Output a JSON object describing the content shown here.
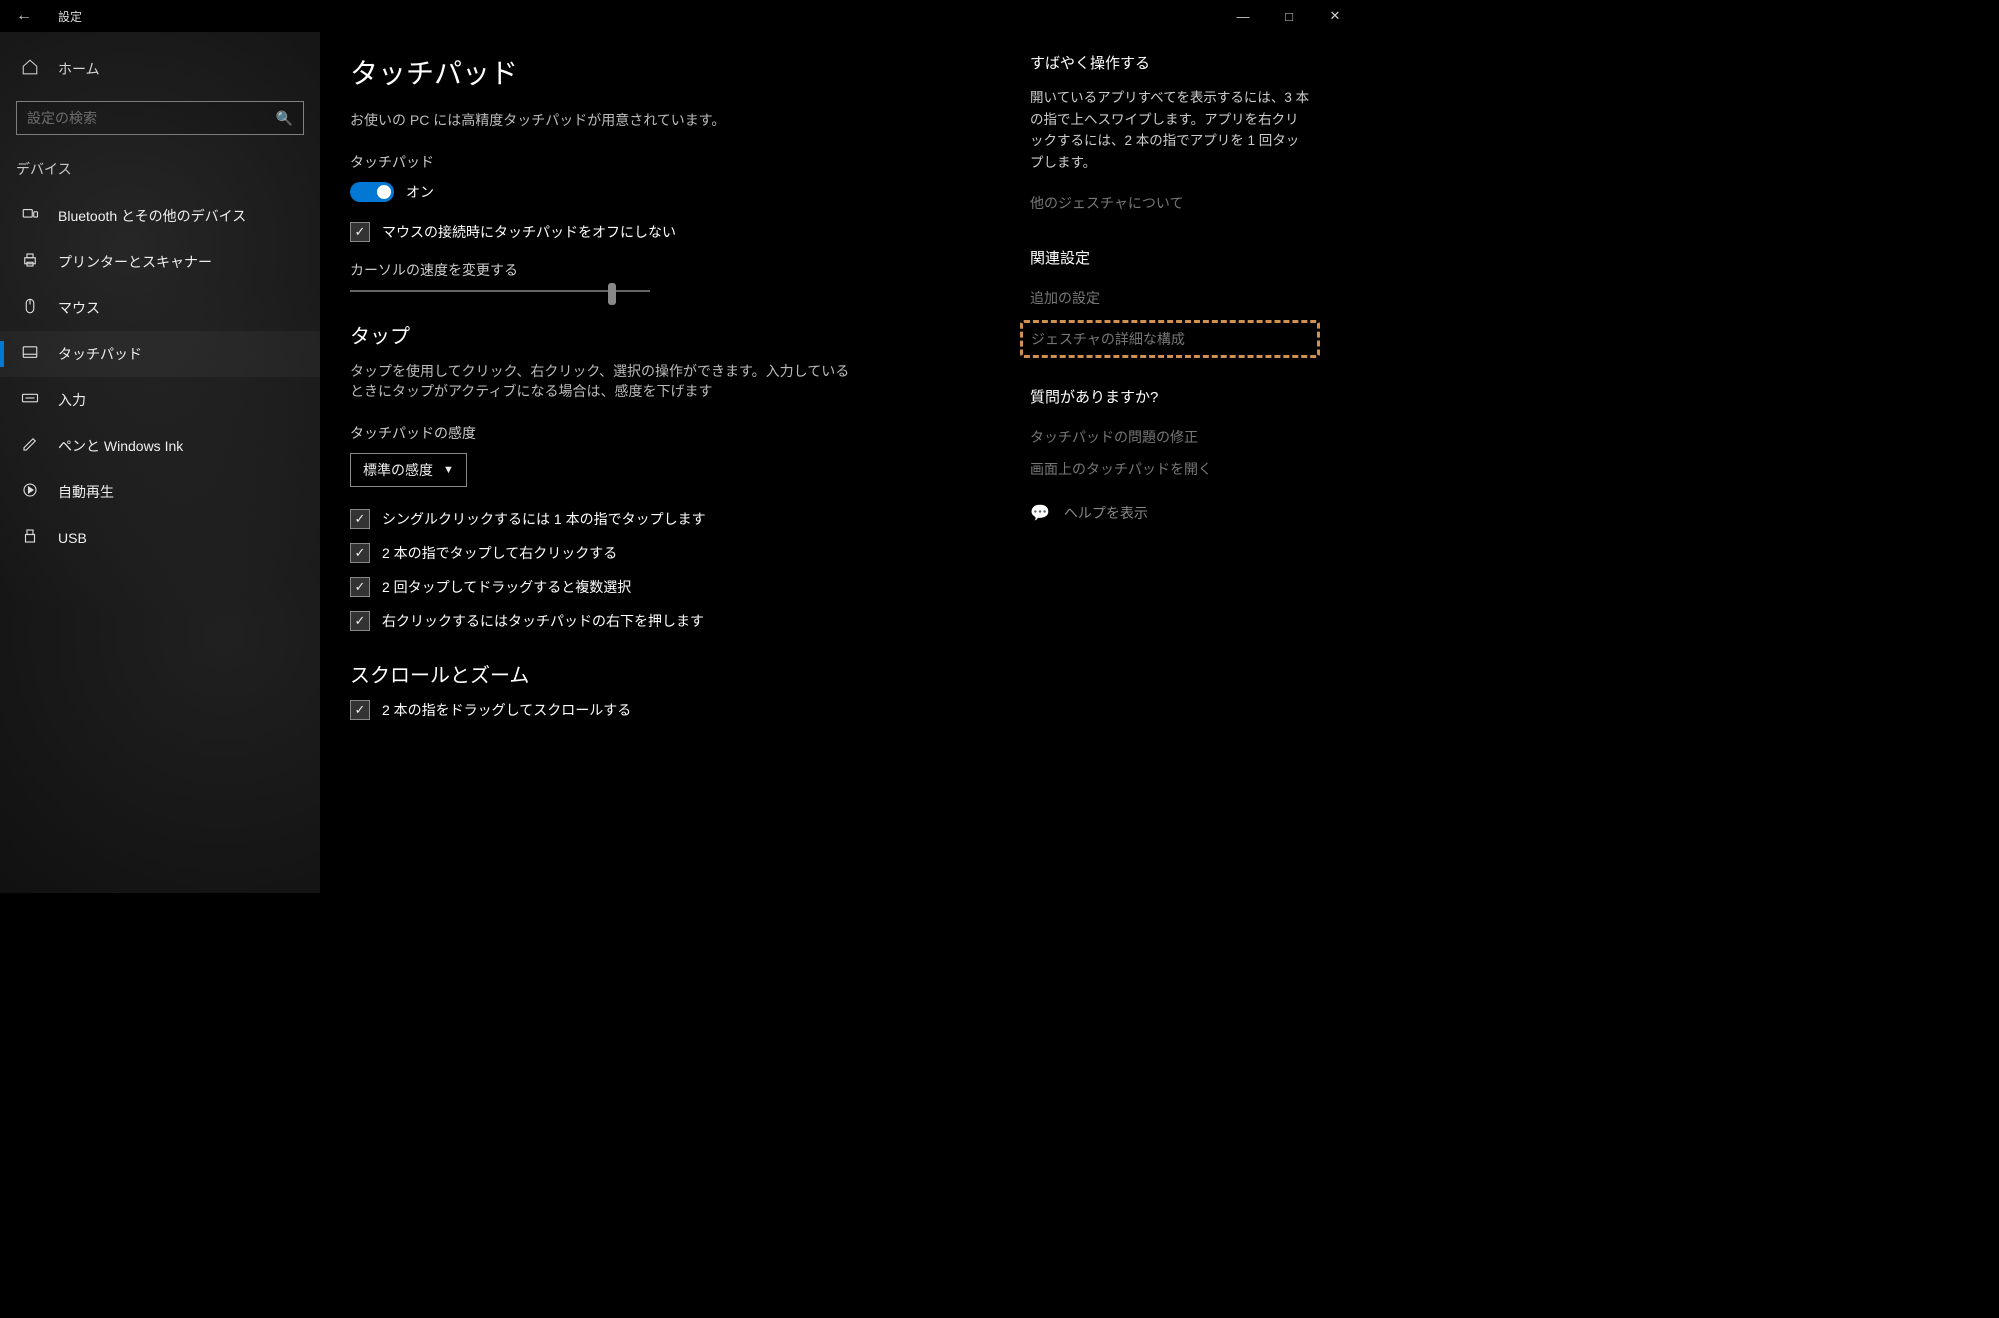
{
  "window": {
    "title": "設定"
  },
  "sidebar": {
    "home_label": "ホーム",
    "search_placeholder": "設定の検索",
    "section": "デバイス",
    "items": [
      {
        "label": "Bluetooth とその他のデバイス"
      },
      {
        "label": "プリンターとスキャナー"
      },
      {
        "label": "マウス"
      },
      {
        "label": "タッチパッド"
      },
      {
        "label": "入力"
      },
      {
        "label": "ペンと Windows Ink"
      },
      {
        "label": "自動再生"
      },
      {
        "label": "USB"
      }
    ]
  },
  "main": {
    "title": "タッチパッド",
    "intro": "お使いの PC には高精度タッチパッドが用意されています。",
    "touchpad_label": "タッチパッド",
    "toggle_state": "オン",
    "mouse_checkbox": "マウスの接続時にタッチパッドをオフにしない",
    "cursor_speed_label": "カーソルの速度を変更する",
    "tap_heading": "タップ",
    "tap_desc": "タップを使用してクリック、右クリック、選択の操作ができます。入力しているときにタップがアクティブになる場合は、感度を下げます",
    "sensitivity_label": "タッチパッドの感度",
    "sensitivity_value": "標準の感度",
    "tap_options": [
      "シングルクリックするには 1 本の指でタップします",
      "2 本の指でタップして右クリックする",
      "2 回タップしてドラッグすると複数選択",
      "右クリックするにはタッチパッドの右下を押します"
    ],
    "scroll_heading": "スクロールとズーム",
    "scroll_option1": "2 本の指をドラッグしてスクロールする"
  },
  "right": {
    "quick_heading": "すばやく操作する",
    "quick_para": "開いているアプリすべてを表示するには、3 本の指で上へスワイプします。アプリを右クリックするには、2 本の指でアプリを 1 回タップします。",
    "quick_link": "他のジェスチャについて",
    "related_heading": "関連設定",
    "related_link1": "追加の設定",
    "related_link2": "ジェスチャの詳細な構成",
    "question_heading": "質問がありますか?",
    "q_link1": "タッチパッドの問題の修正",
    "q_link2": "画面上のタッチパッドを開く",
    "help_label": "ヘルプを表示"
  }
}
